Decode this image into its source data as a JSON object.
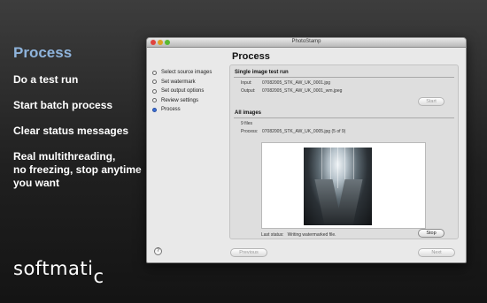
{
  "promo": {
    "title": "Process",
    "bullets": [
      "Do a test run",
      "Start batch process",
      "Clear status messages",
      "Real multithreading,\nno freezing, stop anytime you want"
    ],
    "brand_main": "softmati",
    "brand_sub": "c"
  },
  "window": {
    "title": "PhotoStamp",
    "steps": [
      {
        "label": "Select source images",
        "active": false
      },
      {
        "label": "Set watermark",
        "active": false
      },
      {
        "label": "Set output options",
        "active": false
      },
      {
        "label": "Review settings",
        "active": false
      },
      {
        "label": "Process",
        "active": true
      }
    ],
    "page_title": "Process",
    "test_run": {
      "section_title": "Single image test run",
      "input_label": "Input:",
      "input_value": "07082005_STK_AW_UK_0001.jpg",
      "output_label": "Output:",
      "output_value": "07082005_STK_AW_UK_0001_wm.jpeg",
      "start_label": "Start"
    },
    "all_images": {
      "section_title": "All images",
      "count": "9 files",
      "process_label": "Process:",
      "process_value": "07082005_STK_AW_UK_0005.jpg (5 of 9)",
      "status_label": "Last status:",
      "status_value": "Writing watermarked file.",
      "stop_label": "Stop"
    },
    "help_label": "?",
    "previous_label": "Previous",
    "next_label": "Next"
  }
}
